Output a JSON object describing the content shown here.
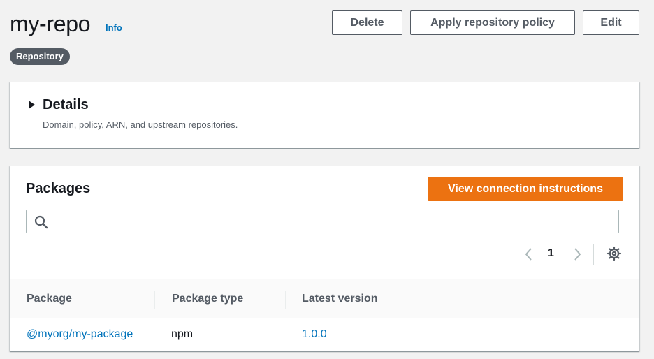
{
  "header": {
    "title": "my-repo",
    "info_label": "Info",
    "badge": "Repository",
    "buttons": {
      "delete": "Delete",
      "apply_policy": "Apply repository policy",
      "edit": "Edit"
    }
  },
  "details": {
    "title": "Details",
    "description": "Domain, policy, ARN, and upstream repositories."
  },
  "packages": {
    "title": "Packages",
    "primary_button": "View connection instructions",
    "search": {
      "value": "",
      "placeholder": ""
    },
    "pagination": {
      "current_page": "1"
    },
    "columns": [
      "Package",
      "Package type",
      "Latest version"
    ],
    "rows": [
      {
        "package": "@myorg/my-package",
        "type": "npm",
        "version": "1.0.0"
      }
    ]
  },
  "colors": {
    "primary": "#ec7211",
    "link": "#0073bb",
    "badge": "#545b64"
  }
}
